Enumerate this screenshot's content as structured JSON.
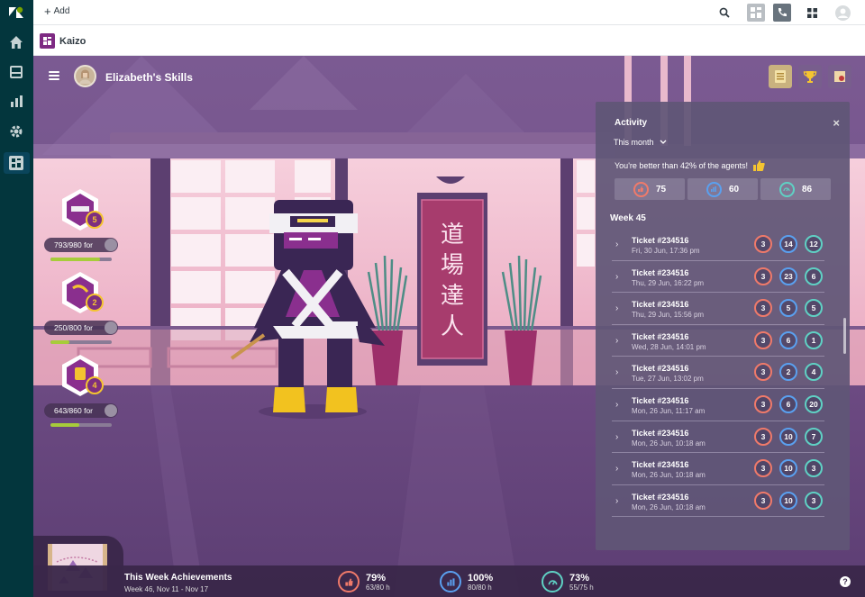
{
  "topbar": {
    "add_label": "Add",
    "icons": [
      "search-icon",
      "qr-app-icon",
      "phone-icon",
      "apps-grid-icon",
      "user-avatar-icon"
    ]
  },
  "app": {
    "name": "Kaizo"
  },
  "scene": {
    "title": "Elizabeth's Skills",
    "sign_text": [
      "道",
      "場",
      "達",
      "人"
    ]
  },
  "skills": [
    {
      "level": "5",
      "value": "793/980 for",
      "progress": 0.81,
      "icon": "headband-icon"
    },
    {
      "level": "2",
      "value": "250/800 for",
      "progress": 0.31,
      "icon": "nunchaku-icon"
    },
    {
      "level": "4",
      "value": "643/860 for",
      "progress": 0.47,
      "icon": "bell-icon"
    }
  ],
  "activity": {
    "title": "Activity",
    "period": "This month",
    "compare_text": "You're better than 42% of the agents!",
    "stats": [
      {
        "value": "75",
        "icon": "thumbs-up-icon",
        "color": "#f07a6a"
      },
      {
        "value": "60",
        "icon": "bar-chart-icon",
        "color": "#5aa0ef"
      },
      {
        "value": "86",
        "icon": "speed-icon",
        "color": "#5fd1c4"
      }
    ],
    "week": "Week 45",
    "tickets": [
      {
        "name": "Ticket #234516",
        "date": "Fri, 30 Jun, 17:36 pm",
        "a": "3",
        "b": "14",
        "c": "12"
      },
      {
        "name": "Ticket #234516",
        "date": "Thu, 29 Jun, 16:22 pm",
        "a": "3",
        "b": "23",
        "c": "6"
      },
      {
        "name": "Ticket #234516",
        "date": "Thu, 29 Jun, 15:56 pm",
        "a": "3",
        "b": "5",
        "c": "5"
      },
      {
        "name": "Ticket #234516",
        "date": "Wed, 28 Jun, 14:01 pm",
        "a": "3",
        "b": "6",
        "c": "1"
      },
      {
        "name": "Ticket #234516",
        "date": "Tue, 27 Jun, 13:02 pm",
        "a": "3",
        "b": "2",
        "c": "4"
      },
      {
        "name": "Ticket #234516",
        "date": "Mon, 26 Jun, 11:17 am",
        "a": "3",
        "b": "6",
        "c": "20"
      },
      {
        "name": "Ticket #234516",
        "date": "Mon, 26 Jun, 10:18 am",
        "a": "3",
        "b": "10",
        "c": "7"
      },
      {
        "name": "Ticket #234516",
        "date": "Mon, 26 Jun, 10:18 am",
        "a": "3",
        "b": "10",
        "c": "3"
      },
      {
        "name": "Ticket #234516",
        "date": "Mon, 26 Jun, 10:18 am",
        "a": "3",
        "b": "10",
        "c": "3"
      }
    ]
  },
  "achievements": {
    "title": "This Week Achievements",
    "subtitle": "Week 46, Nov 11 - Nov 17",
    "metrics": [
      {
        "pct": "79%",
        "hours": "63/80 h",
        "color": "#f07a6a",
        "icon": "thumbs-up-icon"
      },
      {
        "pct": "100%",
        "hours": "80/80 h",
        "color": "#5aa0ef",
        "icon": "bar-chart-icon"
      },
      {
        "pct": "73%",
        "hours": "55/75 h",
        "color": "#5fd1c4",
        "icon": "speed-icon"
      }
    ],
    "help": "?"
  },
  "colors": {
    "nav": "#03363d",
    "accent": "#7e2a83",
    "ring_red": "#f07a6a",
    "ring_blue": "#5aa0ef",
    "ring_teal": "#5fd1c4",
    "progress": "#a7cc3a"
  }
}
